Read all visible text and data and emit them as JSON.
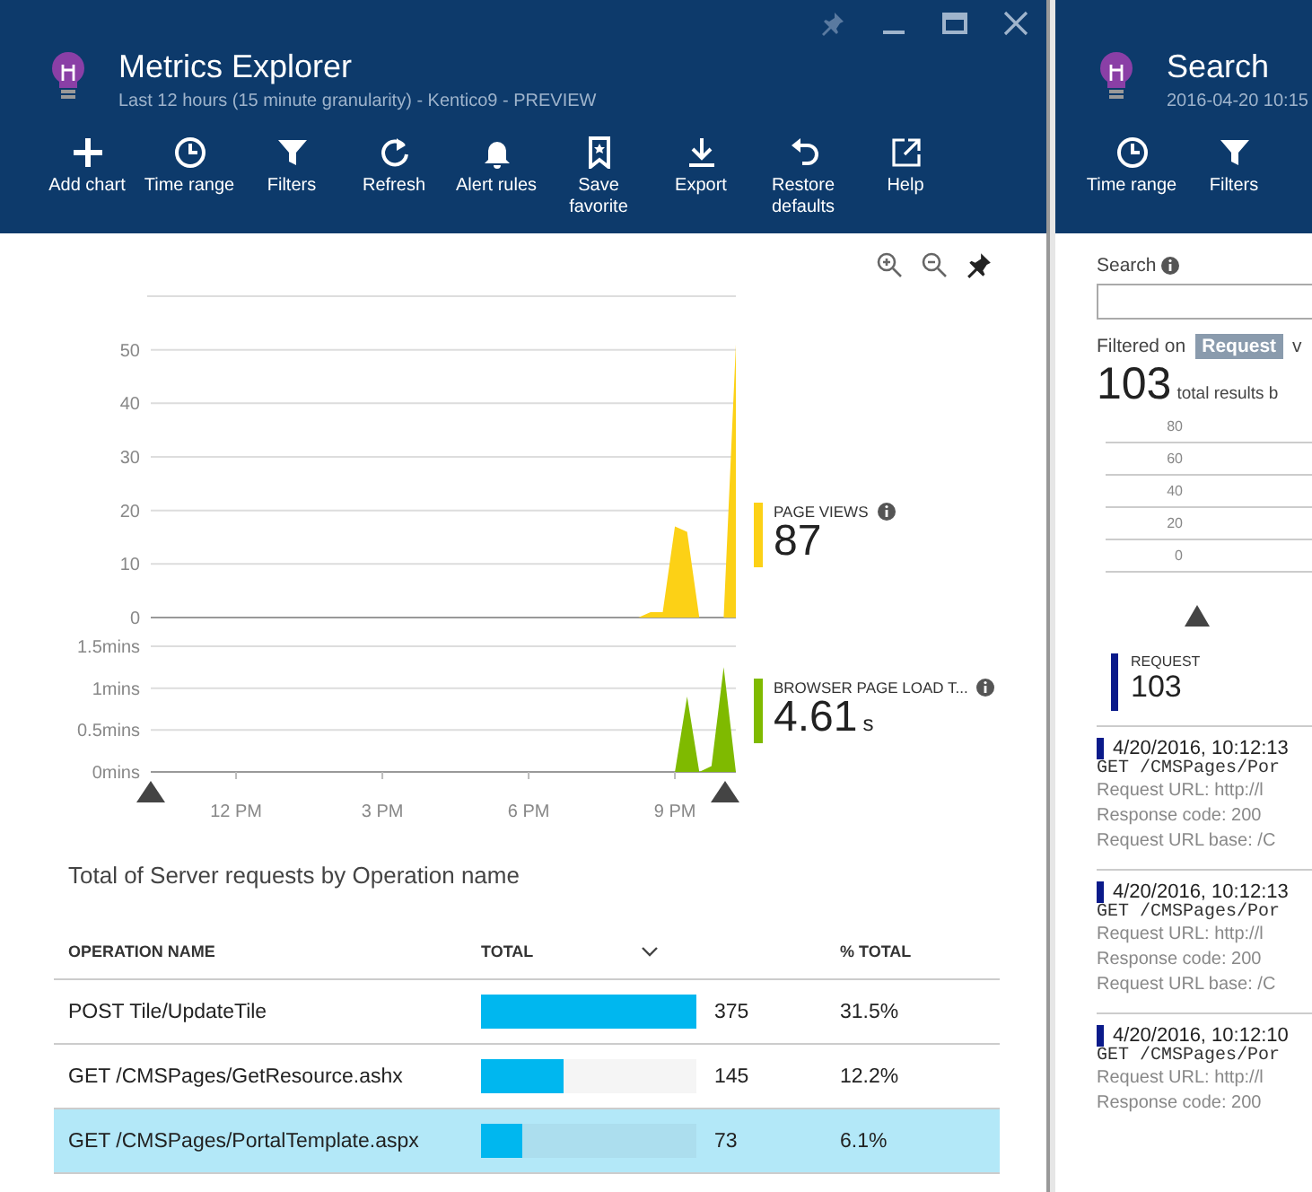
{
  "window": {
    "title": "Metrics Explorer",
    "subtitle": "Last 12 hours (15 minute granularity) - Kentico9 - PREVIEW"
  },
  "toolbar": [
    {
      "label": "Add chart",
      "kind": "plus"
    },
    {
      "label": "Time range",
      "kind": "clock"
    },
    {
      "label": "Filters",
      "kind": "funnel"
    },
    {
      "label": "Refresh",
      "kind": "refresh"
    },
    {
      "label": "Alert rules",
      "kind": "bell"
    },
    {
      "label": "Save favorite",
      "kind": "bookmark"
    },
    {
      "label": "Export",
      "kind": "download"
    },
    {
      "label": "Restore defaults",
      "kind": "undo"
    },
    {
      "label": "Help",
      "kind": "external"
    }
  ],
  "charts": [
    {
      "legend": {
        "label": "PAGE VIEWS",
        "value": "87"
      },
      "chart_data": {
        "type": "area",
        "grid": true,
        "ylim": [
          0,
          60
        ],
        "yticks": [
          0,
          10,
          20,
          30,
          40,
          50
        ],
        "categories": [
          null,
          null,
          null,
          null,
          null,
          null,
          null,
          null,
          null,
          null,
          null,
          null,
          null,
          null,
          null,
          null,
          null,
          null,
          null,
          null,
          null,
          null,
          null,
          null,
          null,
          null,
          null,
          null,
          null,
          null,
          null,
          null,
          null,
          null,
          null,
          null,
          null,
          null,
          null,
          null,
          null,
          null,
          null,
          null,
          null,
          null,
          null,
          null,
          null
        ],
        "series": [
          {
            "color": "#fcd116",
            "values": [
              0,
              0,
              0,
              0,
              0,
              0,
              0,
              0,
              0,
              0,
              0,
              0,
              0,
              0,
              0,
              0,
              0,
              0,
              0,
              0,
              0,
              0,
              0,
              0,
              0,
              0,
              0,
              0,
              0,
              0,
              0,
              0,
              0,
              0,
              0,
              0,
              0,
              0,
              0,
              0,
              0,
              1,
              1,
              17,
              16,
              0,
              0,
              0,
              51
            ]
          }
        ]
      }
    },
    {
      "legend": {
        "label": "BROWSER PAGE LOAD T...",
        "value": "4.61",
        "unit": "s"
      },
      "chart_data": {
        "type": "area",
        "grid": true,
        "ylim": [
          0,
          1.5
        ],
        "categories": [
          null,
          null,
          null,
          null,
          null,
          null,
          null,
          "12 PM",
          null,
          null,
          null,
          null,
          null,
          null,
          null,
          null,
          null,
          null,
          null,
          "3 PM",
          null,
          null,
          null,
          null,
          null,
          null,
          null,
          null,
          null,
          null,
          null,
          "6 PM",
          null,
          null,
          null,
          null,
          null,
          null,
          null,
          null,
          null,
          null,
          null,
          "9 PM",
          null,
          null,
          null,
          null,
          null
        ],
        "yticks": [
          {
            "value": 0,
            "label": "0mins"
          },
          {
            "value": 0.5,
            "label": "0.5mins"
          },
          {
            "value": 1,
            "label": "1mins"
          },
          {
            "value": 1.5,
            "label": "1.5mins"
          }
        ],
        "series": [
          {
            "color": "#7fba00",
            "values": [
              0,
              0,
              0,
              0,
              0,
              0,
              0,
              0,
              0,
              0,
              0,
              0,
              0,
              0,
              0,
              0,
              0,
              0,
              0,
              0,
              0,
              0,
              0,
              0,
              0,
              0,
              0,
              0,
              0,
              0,
              0,
              0,
              0,
              0,
              0,
              0,
              0,
              0,
              0,
              0,
              0,
              0,
              0,
              0,
              0.9,
              0,
              0.07,
              1.25,
              0
            ]
          }
        ]
      }
    }
  ],
  "table": {
    "title": "Total of Server requests by Operation name",
    "columns": [
      "OPERATION NAME",
      "TOTAL",
      "% TOTAL"
    ],
    "rows": [
      {
        "operation": "POST Tile/UpdateTile",
        "level": 1,
        "total": "375",
        "percent": "31.5%",
        "selected": false
      },
      {
        "operation": "GET /CMSPages/GetResource.ashx",
        "level": 0.387,
        "total": "145",
        "percent": "12.2%",
        "selected": false
      },
      {
        "operation": "GET /CMSPages/PortalTemplate.aspx",
        "level": 0.195,
        "total": "73",
        "percent": "6.1%",
        "selected": true
      }
    ]
  },
  "search_panel": {
    "title": "Search",
    "subtitle": "2016-04-20 10:15",
    "toolbar": [
      {
        "label": "Time range",
        "kind": "clock"
      },
      {
        "label": "Filters",
        "kind": "funnel"
      }
    ],
    "search_label": "Search",
    "filtered_on": "Filtered on",
    "filter_tag": "Request",
    "filter_rest": "v",
    "total": "103",
    "total_text": "total results b",
    "axis_labels": [
      "80",
      "60",
      "40",
      "20",
      "0"
    ],
    "legend": {
      "label": "REQUEST",
      "value": "103"
    },
    "results": [
      {
        "time": "4/20/2016, 10:12:13",
        "request": "GET /CMSPages/Por",
        "lines": [
          "Request URL: http://l",
          "Response code: 200",
          "Request URL base: /C"
        ]
      },
      {
        "time": "4/20/2016, 10:12:13",
        "request": "GET /CMSPages/Por",
        "lines": [
          "Request URL: http://l",
          "Response code: 200",
          "Request URL base: /C"
        ]
      },
      {
        "time": "4/20/2016, 10:12:10",
        "request": "GET /CMSPages/Por",
        "lines": [
          "Request URL: http://l",
          "Response code: 200"
        ]
      }
    ]
  }
}
